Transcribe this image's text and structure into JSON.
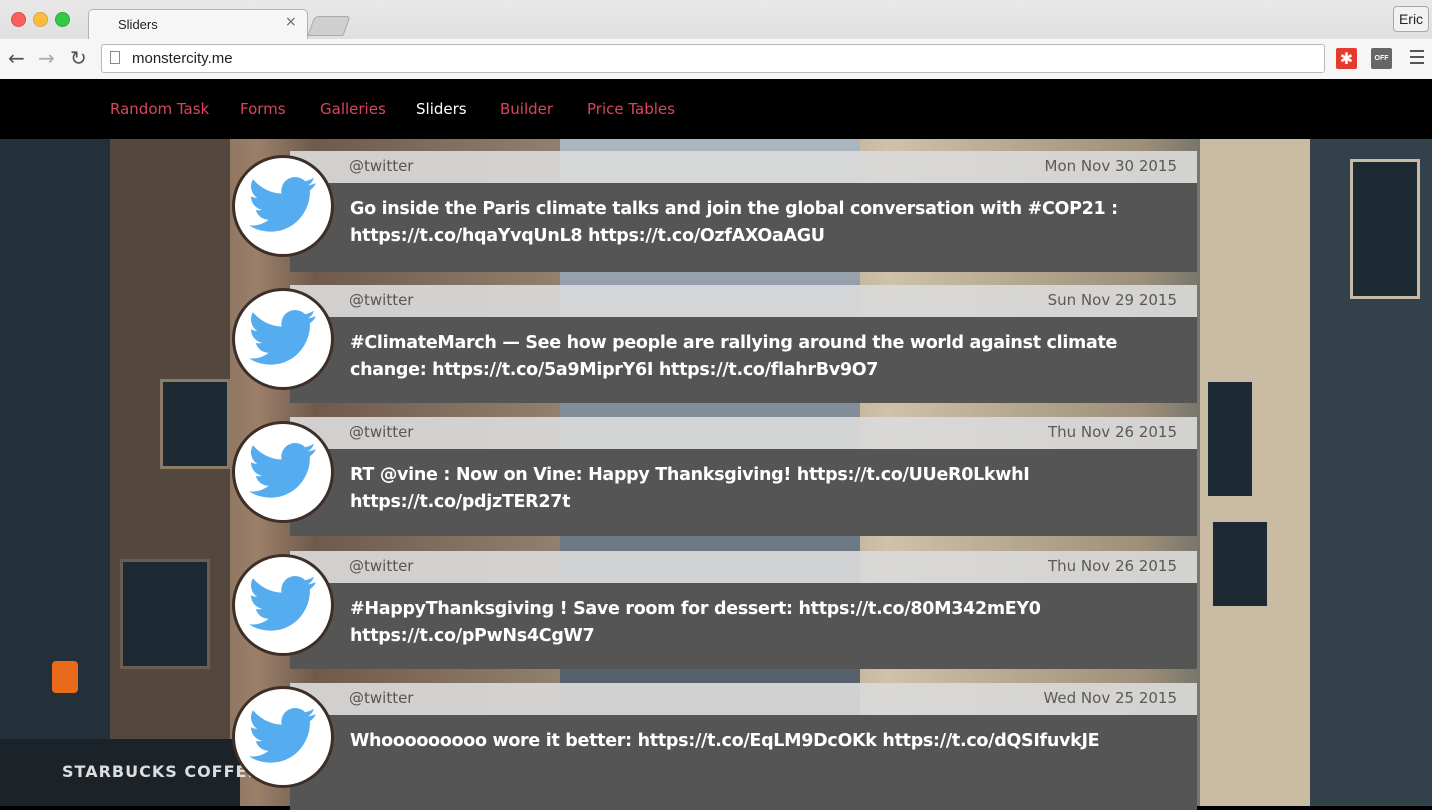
{
  "browser": {
    "tab_title": "Sliders",
    "tab_close": "×",
    "url": "monstercity.me",
    "profile": "Eric",
    "back_icon": "arrow-left-icon",
    "forward_icon": "arrow-right-icon",
    "reload_icon": "reload-icon",
    "ext1_label": "✱",
    "ext2_label": "OFF"
  },
  "nav": {
    "items": [
      {
        "label": "Random Task"
      },
      {
        "label": "Forms"
      },
      {
        "label": "Galleries"
      },
      {
        "label": "Sliders",
        "active": true
      },
      {
        "label": "Builder"
      },
      {
        "label": "Price Tables"
      }
    ],
    "accent": "#d9465c"
  },
  "background": {
    "sign_text": "STARBUCKS COFFEE"
  },
  "tweets": [
    {
      "user": "@twitter",
      "date": "Mon Nov 30 2015",
      "text": "Go inside the Paris climate talks and join the global conversation with #COP21 : https://t.co/hqaYvqUnL8 https://t.co/OzfAXOaAGU"
    },
    {
      "user": "@twitter",
      "date": "Sun Nov 29 2015",
      "text": "#ClimateMarch — See how people are rallying around the world against climate change: https://t.co/5a9MiprY6I https://t.co/flahrBv9O7"
    },
    {
      "user": "@twitter",
      "date": "Thu Nov 26 2015",
      "text": "RT @vine : Now on Vine: Happy Thanksgiving! https://t.co/UUeR0LkwhI https://t.co/pdjzTER27t"
    },
    {
      "user": "@twitter",
      "date": "Thu Nov 26 2015",
      "text": "#HappyThanksgiving ! Save room for dessert: https://t.co/80M342mEY0 https://t.co/pPwNs4CgW7"
    },
    {
      "user": "@twitter",
      "date": "Wed Nov 25 2015",
      "text": "Whooooooooo wore it better: https://t.co/EqLM9DcOKk https://t.co/dQSIfuvkJE"
    }
  ],
  "colors": {
    "twitter_blue": "#55acee",
    "card_body": "#555555",
    "card_head": "#d9d9d9"
  }
}
